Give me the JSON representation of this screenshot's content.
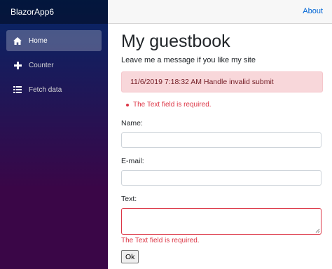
{
  "app": {
    "brand": "BlazorApp6"
  },
  "sidebar": {
    "items": [
      {
        "label": "Home",
        "icon": "home-icon",
        "active": true
      },
      {
        "label": "Counter",
        "icon": "plus-icon",
        "active": false
      },
      {
        "label": "Fetch data",
        "icon": "list-icon",
        "active": false
      }
    ]
  },
  "topbar": {
    "about_label": "About"
  },
  "page": {
    "title": "My guestbook",
    "subtitle": "Leave me a message if you like my site",
    "alert": "11/6/2019 7:18:32 AM Handle invalid submit",
    "validation_summary": [
      "The Text field is required."
    ]
  },
  "form": {
    "name_label": "Name:",
    "name_value": "",
    "email_label": "E-mail:",
    "email_value": "",
    "text_label": "Text:",
    "text_value": "",
    "text_error": "The Text field is required.",
    "submit_label": "Ok"
  },
  "colors": {
    "sidebar_top": "#052767",
    "sidebar_bottom": "#3a0647",
    "link": "#0366d6",
    "error": "#dc3545",
    "alert_bg": "#f8d7da",
    "alert_text": "#721c24"
  }
}
